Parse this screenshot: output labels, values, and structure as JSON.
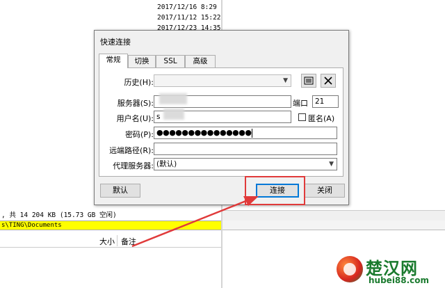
{
  "background": {
    "timestamps": [
      "2017/12/16 8:29",
      "2017/11/12 15:22",
      "2017/12/23 14:35"
    ],
    "status_text": ", 共 14 204 KB (15.73 GB 空闲)",
    "path_text": "s\\TING\\Documents",
    "columns": {
      "size": "大小",
      "note": "备注"
    }
  },
  "dialog": {
    "title": "快速连接",
    "tabs": [
      {
        "label": "常规",
        "active": true
      },
      {
        "label": "切换",
        "active": false
      },
      {
        "label": "SSL",
        "active": false
      },
      {
        "label": "高级",
        "active": false
      }
    ],
    "history": {
      "label": "历史(H):",
      "value": ""
    },
    "server": {
      "label": "服务器(S):",
      "value": ""
    },
    "port": {
      "label": "端口",
      "value": "21"
    },
    "username": {
      "label": "用户名(U):",
      "value": "s"
    },
    "anonymous": {
      "label": "匿名(A)",
      "checked": false
    },
    "password": {
      "label": "密码(P):",
      "value": "●●●●●●●●●●●●●●●"
    },
    "remote_path": {
      "label": "远端路径(R):",
      "value": ""
    },
    "proxy": {
      "label": "代理服务器:",
      "value": "(默认)"
    },
    "buttons": {
      "default": "默认",
      "connect": "连接",
      "close": "关闭"
    }
  },
  "watermark": {
    "name": "楚汉网",
    "url": "hubei88.com"
  },
  "colors": {
    "highlight": "#e03a3a",
    "path_bar": "#ffff00",
    "logo": "#1a7a2e"
  },
  "icons": {
    "history_list": "list-icon",
    "history_delete": "close-icon"
  }
}
